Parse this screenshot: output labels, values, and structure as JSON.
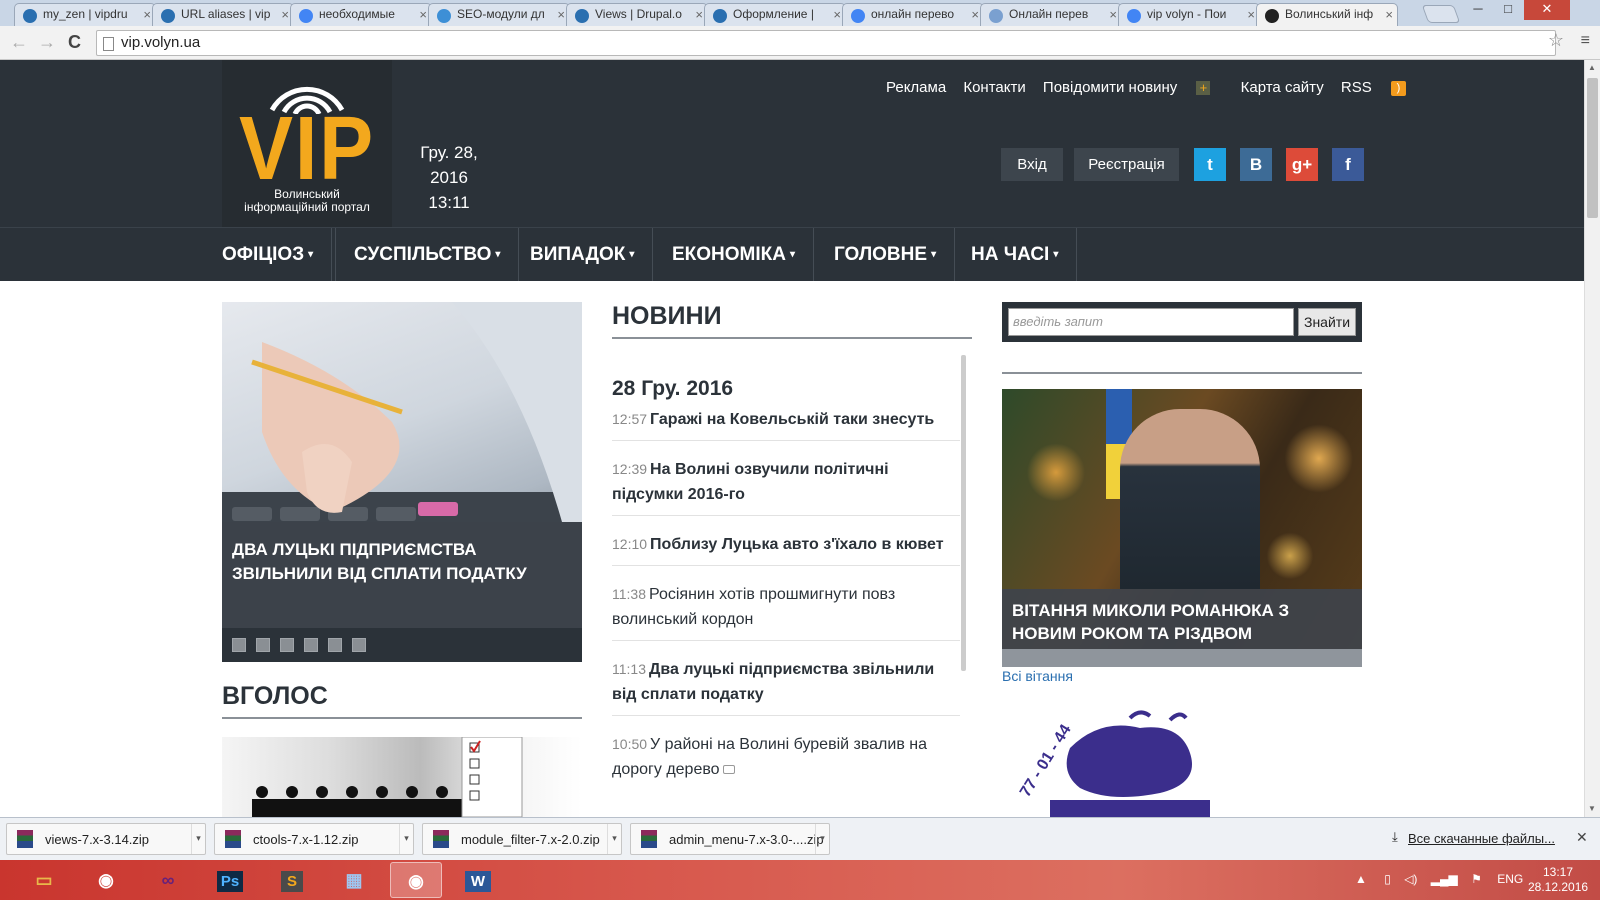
{
  "browser": {
    "tabs": [
      {
        "title": "my_zen | vipdru",
        "color": "#2a6fb0"
      },
      {
        "title": "URL aliases | vip",
        "color": "#2a6fb0"
      },
      {
        "title": "необходимые",
        "color": "#4285f4"
      },
      {
        "title": "SEO-модули дл",
        "color": "#3d8fd6"
      },
      {
        "title": "Views | Drupal.o",
        "color": "#2a6fb0"
      },
      {
        "title": "Оформление |",
        "color": "#2a6fb0"
      },
      {
        "title": "онлайн перево",
        "color": "#4285f4"
      },
      {
        "title": "Онлайн перев",
        "color": "#7aa0d0"
      },
      {
        "title": "vip volyn - Пои",
        "color": "#4285f4"
      },
      {
        "title": "Волинський інф",
        "color": "#222222"
      }
    ],
    "window_controls": {
      "minimize": "─",
      "maximize": "□",
      "close": "✕"
    },
    "address": "vip.volyn.ua",
    "tab_close": "×",
    "back_glyph": "←",
    "forward_glyph": "→",
    "reload_glyph": "C",
    "star_glyph": "☆",
    "menu_glyph": "≡"
  },
  "site": {
    "logo": {
      "text": "VIP",
      "subtitle_line1": "Волинський",
      "subtitle_line2": "інформаційний портал"
    },
    "date": "Гру. 28, 2016",
    "time": "13:11",
    "top_links": [
      "Реклама",
      "Контакти",
      "Повідомити новину",
      "Карта сайту",
      "RSS"
    ],
    "plus_glyph": "+",
    "rss_glyph": ")",
    "login": "Вхід",
    "register": "Реєстрація",
    "social": [
      {
        "name": "twitter",
        "glyph": "t",
        "color": "#1da1e0"
      },
      {
        "name": "vk",
        "glyph": "B",
        "color": "#3d6b96"
      },
      {
        "name": "google-plus",
        "glyph": "g+",
        "color": "#dd4b39"
      },
      {
        "name": "facebook",
        "glyph": "f",
        "color": "#3b5a98"
      }
    ],
    "nav": [
      "ОФІЦІОЗ",
      "СУСПІЛЬСТВО",
      "ВИПАДОК",
      "ЕКОНОМІКА",
      "ГОЛОВНЕ",
      "НА ЧАСІ"
    ],
    "caret": "▾"
  },
  "slider": {
    "caption": "ДВА ЛУЦЬКІ ПІДПРИЄМСТВА ЗВІЛЬНИЛИ ВІД СПЛАТИ ПОДАТКУ",
    "dot_count": 6
  },
  "vgolos": {
    "title": "ВГОЛОС"
  },
  "news": {
    "title": "НОВИНИ",
    "date": "28 Гру. 2016",
    "items": [
      {
        "time": "12:57",
        "headline": "Гаражі на Ковельській таки знесуть",
        "bold": true,
        "photo": false
      },
      {
        "time": "12:39",
        "headline": "На Волині озвучили політичні підсумки 2016-го",
        "bold": true,
        "photo": false
      },
      {
        "time": "12:10",
        "headline": "Поблизу Луцька авто з'їхало в кювет",
        "bold": true,
        "photo": false
      },
      {
        "time": "11:38",
        "headline": "Росіянин хотів прошмигнути повз волинський кордон",
        "bold": false,
        "photo": false
      },
      {
        "time": "11:13",
        "headline": "Два луцькі підприємства звільнили від сплати податку",
        "bold": true,
        "photo": false
      },
      {
        "time": "10:50",
        "headline": "У районі на Волині буревій звалив на дорогу дерево",
        "bold": false,
        "photo": true
      }
    ]
  },
  "search": {
    "placeholder": "введіть запит",
    "button": "Знайти"
  },
  "greeting": {
    "caption": "ВІТАННЯ МИКОЛИ РОМАНЮКА З НОВИМ РОКОМ ТА РІЗДВОМ ХРИСТОВИМ!",
    "all_link": "Всі вітання"
  },
  "promo": {
    "phone": "77 - 01 - 44"
  },
  "downloads": {
    "files": [
      "views-7.x-3.14.zip",
      "ctools-7.x-1.12.zip",
      "module_filter-7.x-2.0.zip",
      "admin_menu-7.x-3.0-....zip"
    ],
    "all": "Все скачанные файлы...",
    "dropdown_glyph": "▾",
    "close_glyph": "✕"
  },
  "taskbar": {
    "apps": [
      {
        "name": "explorer",
        "glyph": "▭",
        "color": "#e8b84a"
      },
      {
        "name": "chrome",
        "glyph": "◉",
        "color": "#f0f0f0"
      },
      {
        "name": "visual-studio",
        "glyph": "∞",
        "color": "#68217a"
      },
      {
        "name": "photoshop",
        "glyph": "Ps",
        "color": "#0e2a44"
      },
      {
        "name": "sublime",
        "glyph": "S",
        "color": "#4a4a4a"
      },
      {
        "name": "control-panel",
        "glyph": "▦",
        "color": "#5a8ac8"
      },
      {
        "name": "chrome-active",
        "glyph": "◉",
        "color": "#f0f0f0"
      },
      {
        "name": "word",
        "glyph": "W",
        "color": "#2b5797"
      }
    ],
    "lang": "ENG",
    "time": "13:17",
    "date": "28.12.2016",
    "tray_up": "▲"
  }
}
